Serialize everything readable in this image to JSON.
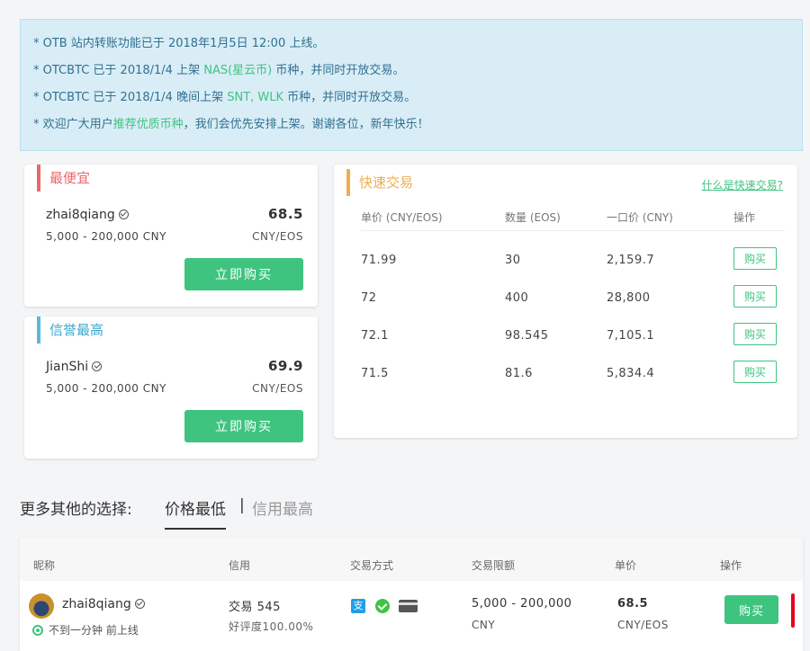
{
  "notice": {
    "line1": "* OTB 站内转账功能已于 2018年1月5日 12:00 上线。",
    "line2_pre": "* OTCBTC 已于 2018/1/4 上架 ",
    "line2_link": "NAS(星云币)",
    "line2_post": " 币种，并同时开放交易。",
    "line3_pre": "* OTCBTC 已于 2018/1/4 晚间上架 ",
    "line3_link": "SNT, WLK",
    "line3_post": " 币种，并同时开放交易。",
    "line4_pre": "* 欢迎广大用户",
    "line4_link": "推荐优质币种",
    "line4_post": "，我们会优先安排上架。谢谢各位，新年快乐！"
  },
  "cheapest": {
    "title": "最便宜",
    "seller": "zhai8qiang",
    "limit": "5,000 - 200,000 CNY",
    "price": "68.5",
    "unit": "CNY/EOS",
    "button": "立即购买"
  },
  "trusted": {
    "title": "信誉最高",
    "seller": "JianShi",
    "limit": "5,000 - 200,000 CNY",
    "price": "69.9",
    "unit": "CNY/EOS",
    "button": "立即购买"
  },
  "quick": {
    "title": "快速交易",
    "link": "什么是快速交易?",
    "headers": [
      "单价 (CNY/EOS)",
      "数量 (EOS)",
      "一口价 (CNY)",
      "操作"
    ],
    "rows": [
      {
        "price": "71.99",
        "qty": "30",
        "total": "2,159.7",
        "action": "购买"
      },
      {
        "price": "72",
        "qty": "400",
        "total": "28,800",
        "action": "购买"
      },
      {
        "price": "72.1",
        "qty": "98.545",
        "total": "7,105.1",
        "action": "购买"
      },
      {
        "price": "71.5",
        "qty": "81.6",
        "total": "5,834.4",
        "action": "购买"
      }
    ]
  },
  "more": {
    "label": "更多其他的选择:",
    "tab_active": "价格最低",
    "separator": "|",
    "tab_inactive": "信用最高"
  },
  "list": {
    "headers": [
      "昵称",
      "信用",
      "交易方式",
      "交易限额",
      "单价",
      "操作"
    ],
    "row": {
      "name": "zhai8qiang",
      "online": "不到一分钟 前上线",
      "trades": "交易 545",
      "rating": "好评度100.00%",
      "alipay_glyph": "支",
      "limit": "5,000 - 200,000",
      "limit_unit": "CNY",
      "price": "68.5",
      "unit": "CNY/EOS",
      "button": "购买"
    }
  },
  "colors": {
    "accent_green": "#3ec47f",
    "notice_bg": "#d9edf7",
    "cheapest_red": "#e8686b",
    "trusted_blue": "#5bb9d8",
    "quick_orange": "#f0ad4e"
  }
}
